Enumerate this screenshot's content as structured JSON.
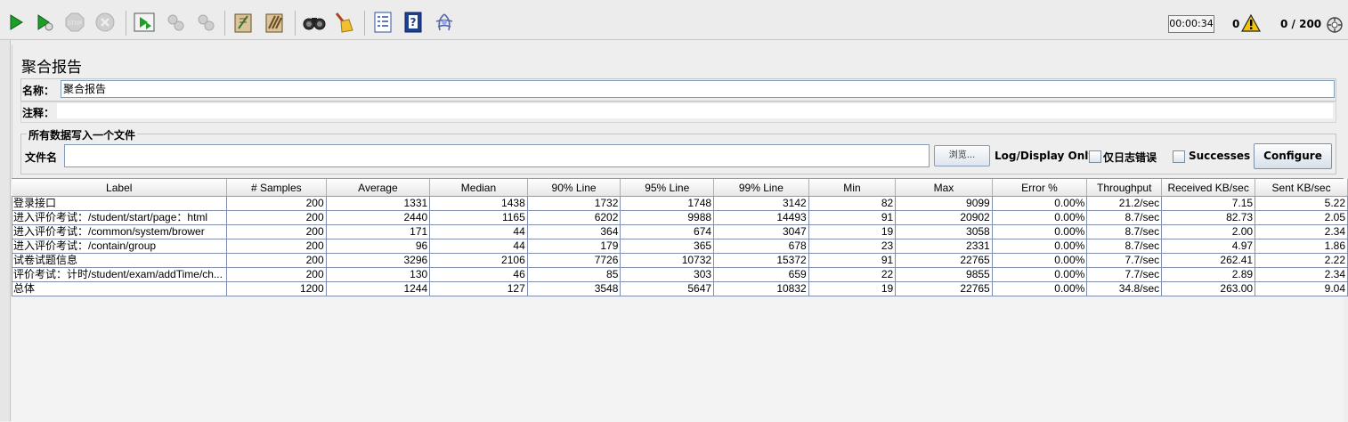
{
  "toolbar": {
    "buttons": [
      {
        "name": "start-icon",
        "color": "#1e9e28"
      },
      {
        "name": "start-no-pause-icon",
        "color": "#1e9e28"
      },
      {
        "name": "stop-icon",
        "color": "#bdbdbd"
      },
      {
        "name": "shutdown-icon",
        "color": "#bdbdbd"
      },
      {
        "name": "remote-start-all-icon",
        "color": "#1e9e28"
      },
      {
        "name": "remote-stop-all-icon",
        "color": "#bdbdbd"
      },
      {
        "name": "remote-shutdown-all-icon",
        "color": "#bdbdbd"
      },
      {
        "name": "clear-icon",
        "color": "#8b6b3a"
      },
      {
        "name": "clear-all-icon",
        "color": "#8b6b3a"
      },
      {
        "name": "search-binoculars-icon",
        "color": "#333333"
      },
      {
        "name": "reset-search-broom-icon",
        "color": "#e0b020"
      },
      {
        "name": "function-helper-icon",
        "color": "#2a4f9c"
      },
      {
        "name": "help-icon",
        "color": "#2a4f9c"
      },
      {
        "name": "log-viewer-icon",
        "color": "#5566aa"
      }
    ],
    "timer": "00:00:34",
    "error_count": "0",
    "thread_count": "0 / 200"
  },
  "page": {
    "title": "聚合报告",
    "name_label": "名称：",
    "name_value": "聚合报告",
    "comment_label": "注释："
  },
  "file_section": {
    "title": "所有数据写入一个文件",
    "filename_label": "文件名",
    "filename_value": "",
    "browse_label": "浏览...",
    "log_display_label": "Log/Display Only:",
    "errors_only_label": "仅日志错误",
    "successes_label": "Successes",
    "configure_label": "Configure"
  },
  "table": {
    "columns": [
      "Label",
      "# Samples",
      "Average",
      "Median",
      "90% Line",
      "95% Line",
      "99% Line",
      "Min",
      "Max",
      "Error %",
      "Throughput",
      "Received KB/sec",
      "Sent KB/sec"
    ],
    "rows": [
      [
        "登录接口",
        "200",
        "1331",
        "1438",
        "1732",
        "1748",
        "3142",
        "82",
        "9099",
        "0.00%",
        "21.2/sec",
        "7.15",
        "5.22"
      ],
      [
        "进入评价考试：/student/start/page：html",
        "200",
        "2440",
        "1165",
        "6202",
        "9988",
        "14493",
        "91",
        "20902",
        "0.00%",
        "8.7/sec",
        "82.73",
        "2.05"
      ],
      [
        "进入评价考试：/common/system/brower",
        "200",
        "171",
        "44",
        "364",
        "674",
        "3047",
        "19",
        "3058",
        "0.00%",
        "8.7/sec",
        "2.00",
        "2.34"
      ],
      [
        "进入评价考试：/contain/group",
        "200",
        "96",
        "44",
        "179",
        "365",
        "678",
        "23",
        "2331",
        "0.00%",
        "8.7/sec",
        "4.97",
        "1.86"
      ],
      [
        "试卷试题信息",
        "200",
        "3296",
        "2106",
        "7726",
        "10732",
        "15372",
        "91",
        "22765",
        "0.00%",
        "7.7/sec",
        "262.41",
        "2.22"
      ],
      [
        "评价考试：计时/student/exam/addTime/ch...",
        "200",
        "130",
        "46",
        "85",
        "303",
        "659",
        "22",
        "9855",
        "0.00%",
        "7.7/sec",
        "2.89",
        "2.34"
      ],
      [
        "总体",
        "1200",
        "1244",
        "127",
        "3548",
        "5647",
        "10832",
        "19",
        "22765",
        "0.00%",
        "34.8/sec",
        "263.00",
        "9.04"
      ]
    ]
  }
}
